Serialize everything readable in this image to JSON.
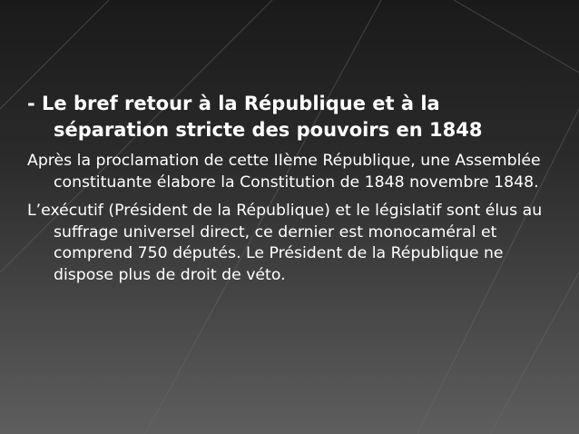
{
  "slide": {
    "heading": "- Le bref retour à la République et à la séparation stricte des pouvoirs en 1848",
    "paragraphs": [
      "Après la proclamation de cette IIème République, une Assemblée constituante élabore la Constitution de 1848 novembre 1848.",
      "L’exécutif (Président de la République) et le législatif sont élus au suffrage universel direct, ce dernier est monocaméral et comprend 750 députés. Le Président de la République ne dispose plus de droit de véto."
    ]
  }
}
